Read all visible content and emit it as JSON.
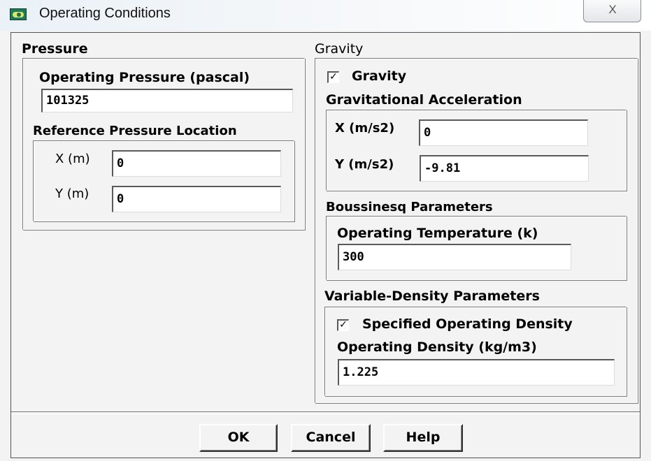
{
  "window": {
    "title": "Operating Conditions",
    "close_glyph": "X"
  },
  "pressure": {
    "group_label": "Pressure",
    "operating_pressure_label": "Operating Pressure (pascal)",
    "operating_pressure_value": "101325",
    "ref_location_label": "Reference Pressure Location",
    "x_label": "X (m)",
    "x_value": "0",
    "y_label": "Y (m)",
    "y_value": "0"
  },
  "gravity": {
    "group_label": "Gravity",
    "checkbox_label": "Gravity",
    "checked": true,
    "accel_label": "Gravitational Acceleration",
    "x_label": "X (m/s2)",
    "x_value": "0",
    "y_label": "Y (m/s2)",
    "y_value": "-9.81"
  },
  "boussinesq": {
    "group_label": "Boussinesq Parameters",
    "temp_label": "Operating Temperature (k)",
    "temp_value": "300"
  },
  "variable_density": {
    "group_label": "Variable-Density Parameters",
    "checkbox_label": "Specified Operating Density",
    "checked": true,
    "density_label": "Operating Density (kg/m3)",
    "density_value": "1.225"
  },
  "buttons": {
    "ok": "OK",
    "cancel": "Cancel",
    "help": "Help"
  },
  "check_glyph": "✓"
}
